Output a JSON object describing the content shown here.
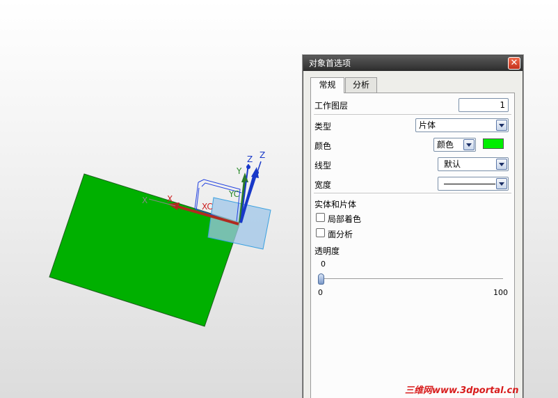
{
  "dialog": {
    "title": "对象首选项",
    "tabs": [
      {
        "label": "常规",
        "active": true
      },
      {
        "label": "分析",
        "active": false
      }
    ],
    "work_layer": {
      "label": "工作图层",
      "value": "1"
    },
    "type": {
      "label": "类型",
      "value": "片体"
    },
    "color": {
      "label": "颜色",
      "value": "颜色",
      "swatch": "#00ee00"
    },
    "line_type": {
      "label": "线型",
      "value": "默认"
    },
    "width": {
      "label": "宽度"
    },
    "solid_sheet": {
      "heading": "实体和片体",
      "local_shading": "局部着色",
      "face_analysis": "面分析"
    },
    "transparency": {
      "label": "透明度",
      "current": "0",
      "min": "0",
      "max": "100",
      "level": 0
    }
  },
  "viewport": {
    "axis_labels": {
      "x": "X",
      "y": "Y",
      "z": "Z",
      "xc": "XC",
      "yc": "YC",
      "zc": "Z"
    },
    "sheet_color": "#00b000",
    "datum_plane_color": "#9fc6e8"
  },
  "watermark": "三维网www.3dportal.cn"
}
